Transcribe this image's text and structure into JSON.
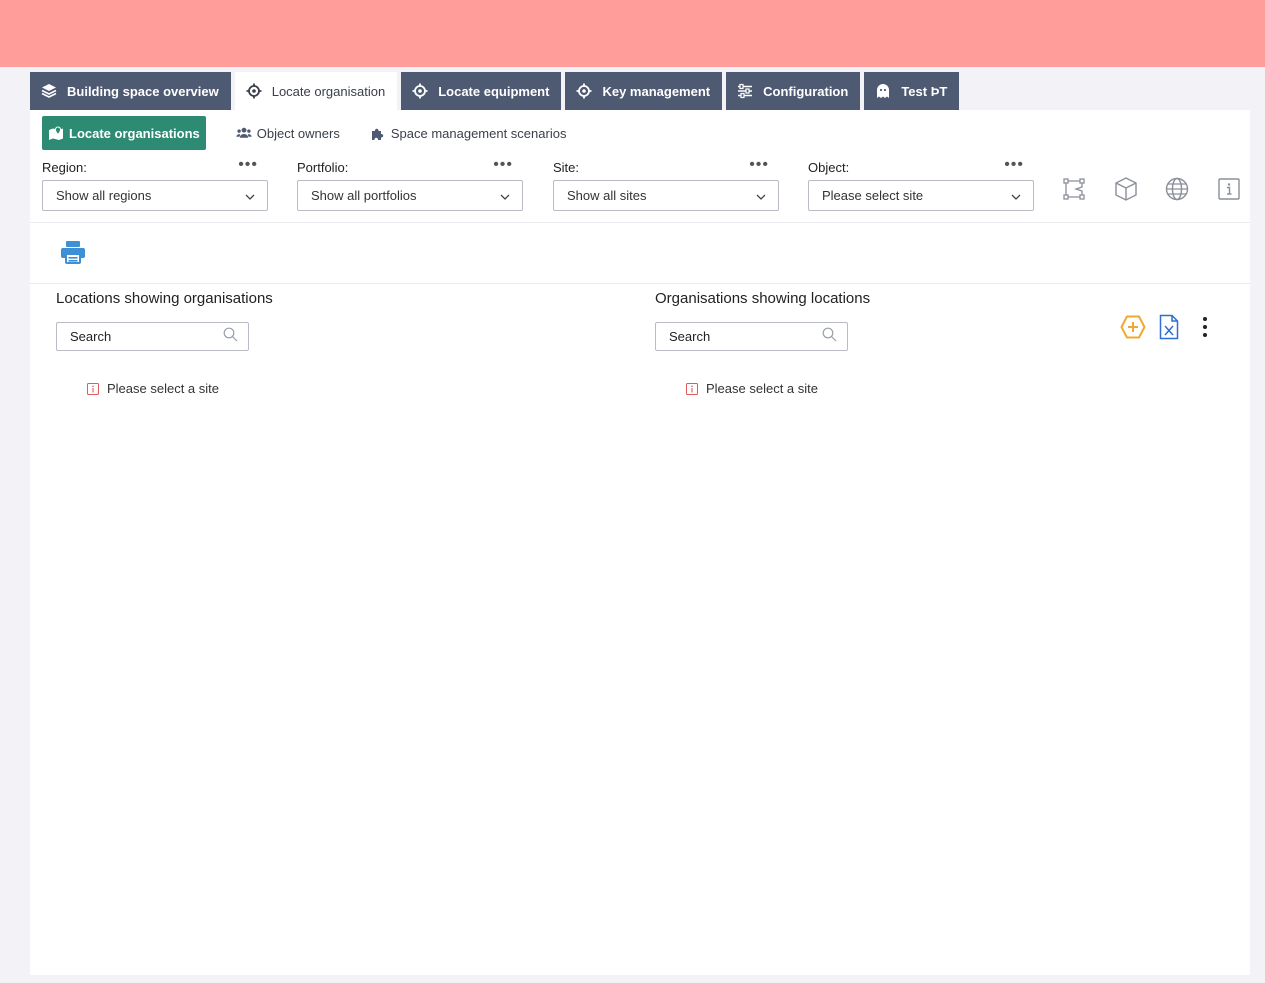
{
  "tabs": [
    {
      "label": "Building space overview",
      "icon": "layers-icon",
      "active": false
    },
    {
      "label": "Locate organisation",
      "icon": "crosshair-icon",
      "active": true
    },
    {
      "label": "Locate equipment",
      "icon": "crosshair-icon",
      "active": false
    },
    {
      "label": "Key management",
      "icon": "crosshair-icon",
      "active": false
    },
    {
      "label": "Configuration",
      "icon": "sliders-icon",
      "active": false
    },
    {
      "label": "Test ÞT",
      "icon": "ghost-icon",
      "active": false
    }
  ],
  "subtabs": [
    {
      "label": "Locate organisations",
      "icon": "map-marker-icon",
      "active": true
    },
    {
      "label": "Object owners",
      "icon": "users-icon",
      "active": false
    },
    {
      "label": "Space management scenarios",
      "icon": "puzzle-icon",
      "active": false
    }
  ],
  "filters": {
    "region": {
      "label": "Region:",
      "value": "Show all regions"
    },
    "portfolio": {
      "label": "Portfolio:",
      "value": "Show all portfolios"
    },
    "site": {
      "label": "Site:",
      "value": "Show all sites"
    },
    "object": {
      "label": "Object:",
      "value": "Please select site"
    }
  },
  "view_icons": [
    "floorplan-icon",
    "cube-icon",
    "globe-icon",
    "info-icon"
  ],
  "left": {
    "title": "Locations showing organisations",
    "search_placeholder": "Search",
    "message": "Please select a site"
  },
  "right": {
    "title": "Organisations showing locations",
    "search_placeholder": "Search",
    "message": "Please select a site"
  },
  "colors": {
    "topbar": "#ff9d9a",
    "tab_bg": "#4e5972",
    "accent_green": "#2d8a73",
    "print_blue": "#3d8fd6",
    "add_orange": "#f0a830",
    "excel_blue": "#2f6fd1",
    "info_red": "#e05a5a"
  }
}
